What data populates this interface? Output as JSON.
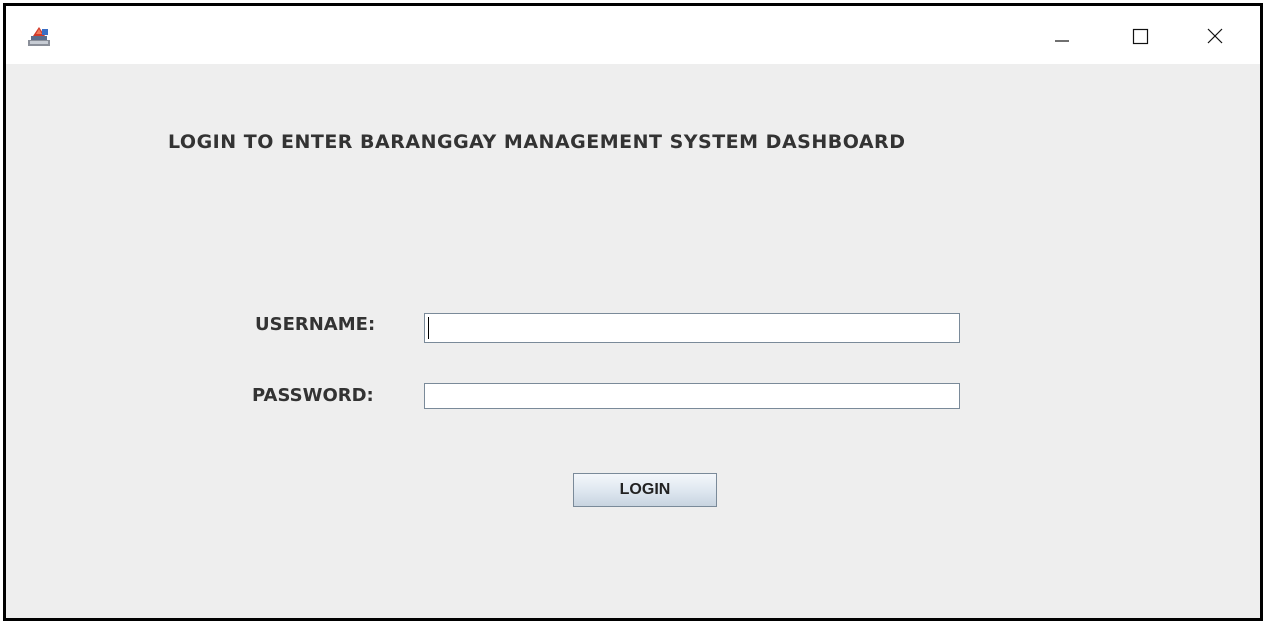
{
  "window": {
    "app_icon": "java-app-icon",
    "controls": {
      "minimize_icon": "minimize-icon",
      "maximize_icon": "maximize-icon",
      "close_icon": "close-icon"
    }
  },
  "heading": "LOGIN TO ENTER BARANGGAY MANAGEMENT SYSTEM DASHBOARD",
  "form": {
    "username_label": "USERNAME:",
    "username_value": "",
    "password_label": "PASSWORD:",
    "password_value": "",
    "login_label": "LOGIN"
  },
  "colors": {
    "window_background": "#eeeeee",
    "title_bar": "#ffffff",
    "window_border": "#000000",
    "label_text": "#333333"
  }
}
